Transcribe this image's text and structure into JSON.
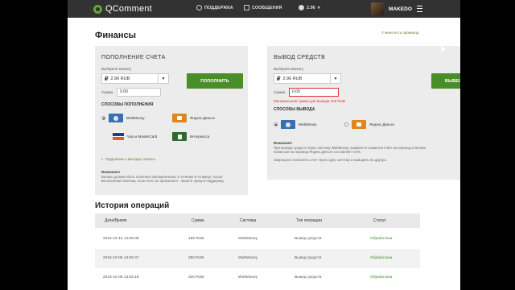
{
  "header": {
    "brand": "QComment",
    "nav": [
      {
        "label": "ПОДДЕРЖКА",
        "icon": "support-icon"
      },
      {
        "label": "СООБЩЕНИЯ",
        "icon": "messages-icon"
      },
      {
        "label": "2.96",
        "icon": "ruble-coin-icon"
      }
    ],
    "username": "MAKEDO"
  },
  "page": {
    "title": "Финансы",
    "history_link": "У меня есть промокод"
  },
  "deposit": {
    "title": "ПОПОЛНЕНИЕ СЧЕТА",
    "currency_label": "Выберите валюту",
    "currency_value": "2.96 RUB",
    "amount_label": "Сумма",
    "amount_value": "0.00",
    "button": "ПОПОЛНИТЬ",
    "methods_title": "СПОСОБЫ ПОПОЛНЕНИЯ",
    "methods": [
      {
        "label": "WebMoney",
        "selected": true
      },
      {
        "label": "Яндекс.Деньги",
        "selected": false
      },
      {
        "label": "Visa и MasterCard",
        "selected": false
      },
      {
        "label": "Интеркасса",
        "selected": false
      }
    ],
    "more_link": "Подробнее о методах оплаты",
    "note_title": "Внимание!",
    "note_text": "Баланс должен быть пополнен автоматически, в течение 5-ти минут, после выполнения платежа, если этого не произошло - пишите сразу в поддержку."
  },
  "withdraw": {
    "title": "ВЫВОД СРЕДСТВ",
    "currency_label": "Выберите валюту",
    "currency_value": "2.96 RUB",
    "amount_label": "Сумма",
    "amount_value": "0.00",
    "button": "ВЫВЕСТИ",
    "error": "Минимальная сумма для вывода 100 RUB",
    "methods_title": "СПОСОБЫ ВЫВОДА",
    "methods": [
      {
        "label": "WebMoney",
        "selected": true
      },
      {
        "label": "Яндекс.Деньги",
        "selected": false
      }
    ],
    "note_title": "Внимание!",
    "note_line1": "При выводе средств через систему WebMoney, взимается комиссия 0.8% на перевод платежа.",
    "note_line2": "Комиссия на перевод Яндекс.Деньги составляет 0.5%.",
    "note_line3": "Запрещено пополнять счет через одну систему и выводить на другую."
  },
  "history": {
    "title": "История операций",
    "columns": [
      "Дата/Время",
      "Сумма",
      "Система",
      "Тип операции",
      "Статус"
    ],
    "rows": [
      [
        "2016-10-12 14:06:08",
        "185 RUB",
        "WebMoney",
        "Вывод средств",
        "Обработана"
      ],
      [
        "2016-10-06 13:09:47",
        "250 RUB",
        "WebMoney",
        "Вывод средств",
        "Обработана"
      ],
      [
        "2016-10-05 13:55:18",
        "320 RUB",
        "WebMoney",
        "Вывод средств",
        "Обработана"
      ]
    ]
  },
  "colors": {
    "header_bg": "#323232",
    "accent_green": "#4a8e2a",
    "panel_bg": "#ececec",
    "error_red": "#d33333"
  }
}
